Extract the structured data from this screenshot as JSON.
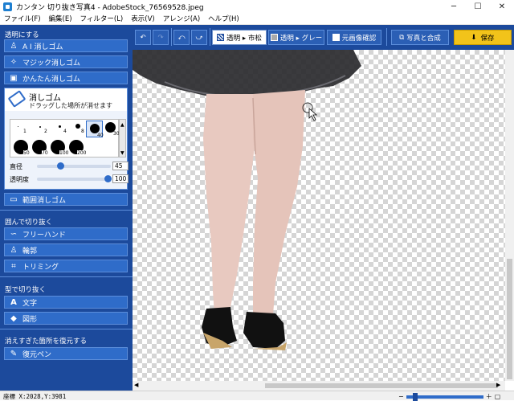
{
  "window": {
    "title": "カンタン 切り抜き写真4 - AdobeStock_76569528.jpeg",
    "minimize": "─",
    "maximize": "☐",
    "close": "✕"
  },
  "menu": [
    "ファイル(F)",
    "編集(E)",
    "フィルター(L)",
    "表示(V)",
    "アレンジ(A)",
    "ヘルプ(H)"
  ],
  "toolbar": {
    "undo": "↶",
    "redo": "↷",
    "rotate_left": "⤺",
    "rotate_right": "⤻",
    "bg_checker": "透明 ▸ 市松",
    "bg_gray": "透明 ▸ グレー",
    "original_check": "元画像確認",
    "compose": "写真と合成",
    "save": "保存"
  },
  "sidebar": {
    "make_transparent": "透明にする",
    "ai_erase": "A I 消しゴム",
    "magic_erase": "マジック消しゴム",
    "easy_erase": "かんたん消しゴム",
    "eraser_title": "消しゴム",
    "eraser_desc": "ドラッグした場所が消せます",
    "brush_sizes": [
      "1",
      "2",
      "4",
      "8",
      "40",
      "30",
      "50",
      "70",
      "100",
      "200"
    ],
    "diameter_label": "直径",
    "diameter_value": "45",
    "opacity_label": "透明度",
    "opacity_value": "100",
    "range_erase": "範囲消しゴム",
    "enclose_cut": "囲んで切り抜く",
    "freehand": "フリーハンド",
    "outline": "輪郭",
    "trimming": "トリミング",
    "shape_cut": "型で切り抜く",
    "text": "文字",
    "figure": "図形",
    "restore_section": "消えすぎた箇所を復元する",
    "restore_pen": "復元ペン"
  },
  "status": {
    "coords": "座標 X:2028,Y:3981"
  },
  "colors": {
    "panel": "#1c4a9c",
    "button": "#2f6cc9",
    "save": "#f2c31a"
  }
}
